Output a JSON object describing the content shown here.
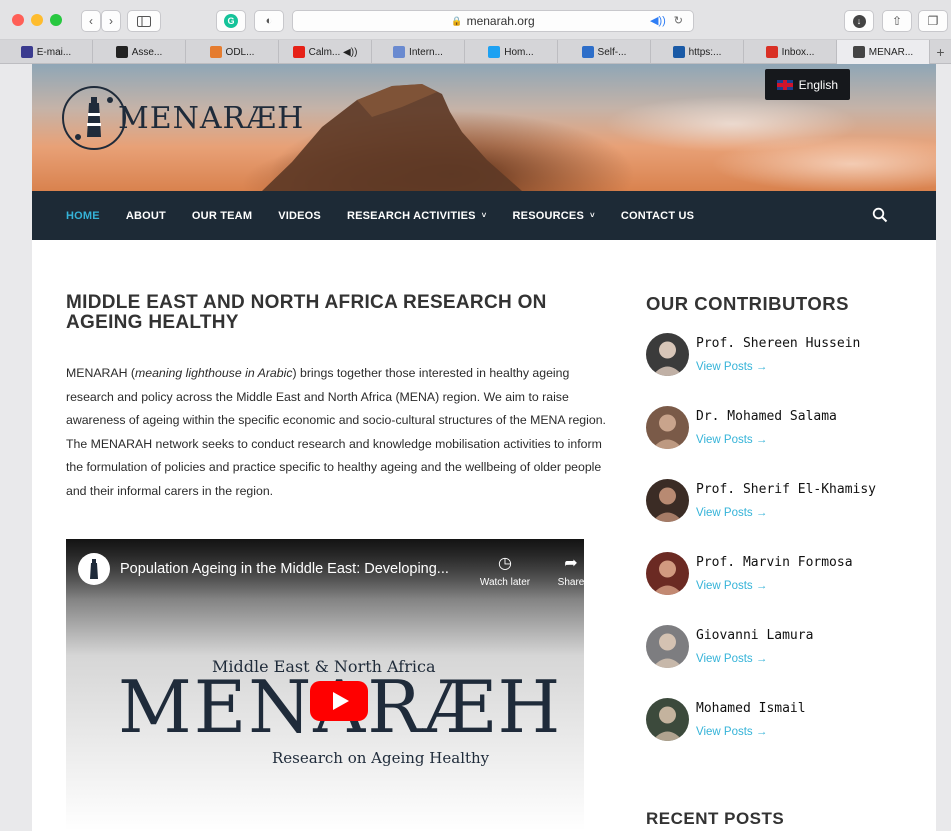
{
  "browser": {
    "url": "menarah.org",
    "tabs": [
      {
        "label": "E-mai...",
        "icon": "ox-icon",
        "color": "#3b3b8f"
      },
      {
        "label": "Asse...",
        "icon": "grid-icon",
        "color": "#222222"
      },
      {
        "label": "ODL...",
        "icon": "o-icon",
        "color": "#e57c2f"
      },
      {
        "label": "Calm... ◀))",
        "icon": "youtube-icon",
        "color": "#e62117"
      },
      {
        "label": "Intern...",
        "icon": "globe-icon",
        "color": "#6a8ad0"
      },
      {
        "label": "Hom...",
        "icon": "twitter-icon",
        "color": "#1da1f2"
      },
      {
        "label": "Self-...",
        "icon": "chat-icon",
        "color": "#2d6ec9"
      },
      {
        "label": "https:...",
        "icon": "un-icon",
        "color": "#1a5aa6"
      },
      {
        "label": "Inbox...",
        "icon": "gmail-icon",
        "color": "#d93025"
      },
      {
        "label": "MENAR...",
        "icon": "lighthouse-icon",
        "color": "#444444"
      }
    ]
  },
  "header": {
    "logo_text": "MENARÆH",
    "language": "English"
  },
  "nav": {
    "items": [
      {
        "label": "HOME",
        "active": true,
        "caret": false
      },
      {
        "label": "ABOUT",
        "active": false,
        "caret": false
      },
      {
        "label": "OUR TEAM",
        "active": false,
        "caret": false
      },
      {
        "label": "VIDEOS",
        "active": false,
        "caret": false
      },
      {
        "label": "RESEARCH ACTIVITIES",
        "active": false,
        "caret": true
      },
      {
        "label": "RESOURCES",
        "active": false,
        "caret": true
      },
      {
        "label": "CONTACT US",
        "active": false,
        "caret": false
      }
    ]
  },
  "main": {
    "title": "MIDDLE EAST AND NORTH AFRICA RESEARCH ON AGEING HEALTHY",
    "intro_lead": "MENARAH (",
    "intro_em": "meaning lighthouse in Arabic",
    "intro_rest": ") brings together those interested in healthy ageing research and policy across the Middle East and North Africa (MENA) region. We aim to raise awareness of ageing within the specific economic and socio-cultural structures of the MENA region. The MENARAH network seeks to conduct research and knowledge mobilisation activities to inform the formulation of policies and practice specific to healthy ageing and the wellbeing of older people and their informal carers in the region."
  },
  "video": {
    "title": "Population Ageing in the Middle East: Developing...",
    "watch_later": "Watch later",
    "share": "Share",
    "subtitle": "Middle East & North Africa",
    "brand": "MENARÆH",
    "tagline": "Research on Ageing Healthy"
  },
  "sidebar": {
    "contributors_title": "OUR CONTRIBUTORS",
    "view_posts": "View Posts →",
    "contributors": [
      {
        "name": "Prof. Shereen Hussein"
      },
      {
        "name": "Dr. Mohamed Salama"
      },
      {
        "name": "Prof. Sherif El-Khamisy"
      },
      {
        "name": "Prof. Marvin Formosa"
      },
      {
        "name": "Giovanni Lamura"
      },
      {
        "name": "Mohamed Ismail"
      }
    ],
    "recent_title": "RECENT POSTS"
  },
  "colors": {
    "accent": "#35b3d8",
    "nav_bg": "#1d2a36"
  }
}
